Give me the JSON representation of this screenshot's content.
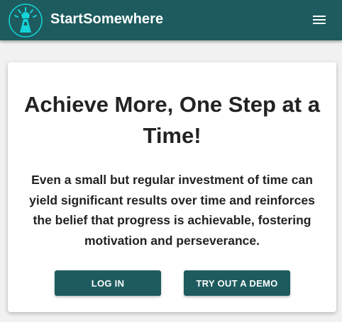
{
  "header": {
    "brand": "StartSomewhere",
    "logo_icon": "lighthouse-icon",
    "menu_icon": "hamburger-menu-icon"
  },
  "hero": {
    "title": "Achieve More, One Step at a Time!",
    "description": "Even a small but regular investment of time can yield significant results over time and reinforces the belief that progress is achievable, fostering motivation and perseverance."
  },
  "actions": {
    "login_label": "LOG IN",
    "demo_label": "TRY OUT A DEMO"
  },
  "colors": {
    "primary": "#1d5b5e",
    "accent": "#14d3d8",
    "background": "#f1f1f1"
  }
}
